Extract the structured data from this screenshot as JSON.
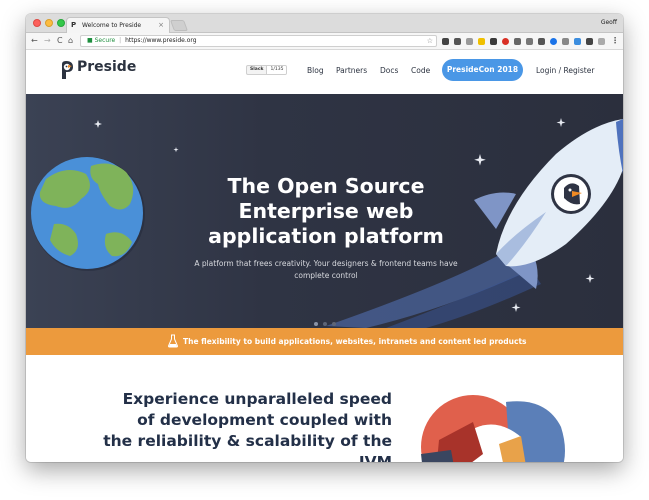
{
  "browser": {
    "tab_title": "Welcome to Preside",
    "tab_favicon": "P",
    "tab_close": "×",
    "profile": "Geoff",
    "back": "←",
    "forward": "→",
    "reload": "C",
    "home": "⌂",
    "lock_icon": "🔒",
    "secure_label": "Secure",
    "url_separator": "|",
    "url": "https://www.preside.org",
    "bookmark_icon": "☆"
  },
  "header": {
    "logo_text": "Preside",
    "slack_label": "Slack",
    "slack_count": "1/135",
    "nav": [
      "Blog",
      "Partners",
      "Docs",
      "Code"
    ],
    "cta_label": "PresideCon 2018",
    "login_label": "Login / Register"
  },
  "hero": {
    "title_lines": [
      "The Open Source",
      "Enterprise web",
      "application platform"
    ],
    "subtitle_lines": [
      "A platform that frees creativity. Your designers & frontend teams have",
      "complete control"
    ]
  },
  "banner": {
    "text": "The flexibility to build applications, websites, intranets and content led products"
  },
  "section": {
    "title_lines": [
      "Experience unparalleled speed",
      "of development coupled with",
      "the reliability & scalability of the",
      "JVM"
    ]
  },
  "colors": {
    "hero_bg": "#2f3444",
    "banner": "#ec9a3d",
    "cta": "#4a97e6",
    "text_dark": "#233048"
  }
}
